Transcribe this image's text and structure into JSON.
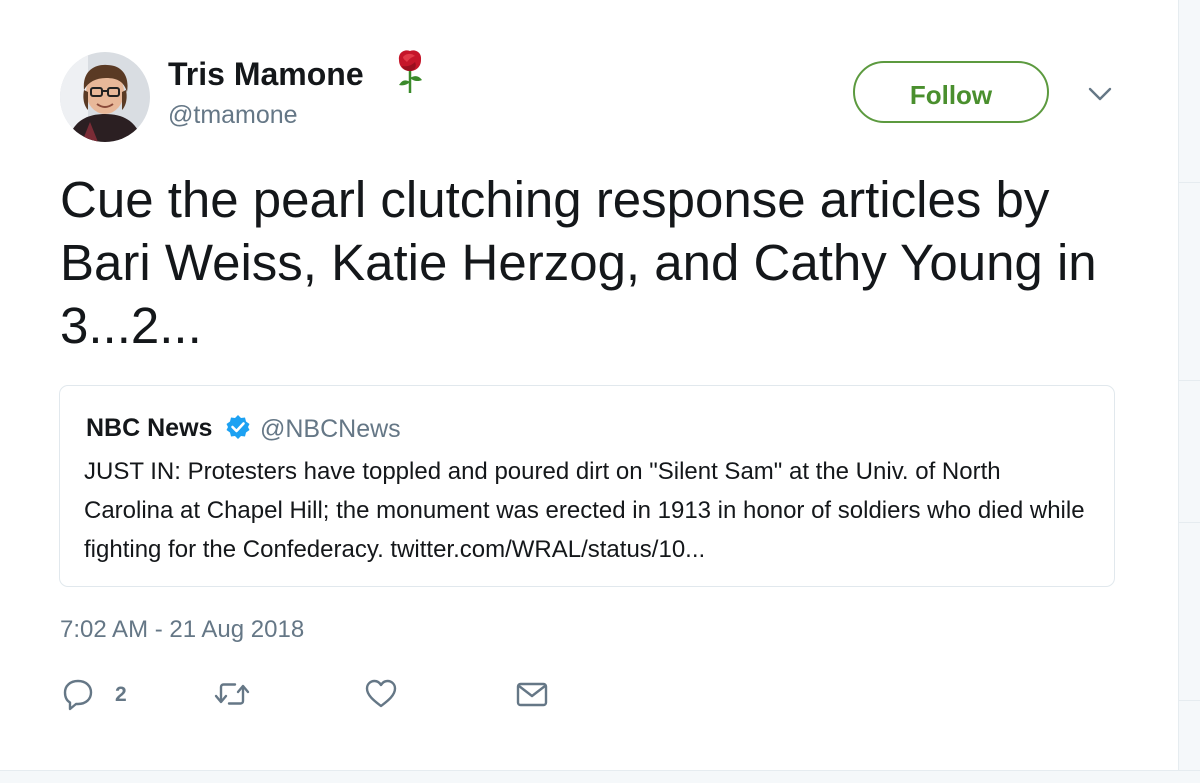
{
  "author": {
    "name": "Tris Mamone",
    "handle": "@tmamone",
    "name_emoji": "rose-icon"
  },
  "follow_button": {
    "label": "Follow",
    "color": "#4a8f2e"
  },
  "tweet": {
    "text": "Cue the pearl clutching response articles by Bari Weiss, Katie Herzog, and Cathy Young in 3...2...",
    "timestamp": "7:02 AM - 21 Aug 2018"
  },
  "quoted_tweet": {
    "name": "NBC News",
    "handle": "@NBCNews",
    "verified": true,
    "text": "JUST IN: Protesters have toppled and poured dirt on \"Silent Sam\" at the Univ. of North Carolina at Chapel Hill; the monument was erected in 1913 in honor of soldiers who died while fighting for the Confederacy. twitter.com/WRAL/status/10..."
  },
  "actions": {
    "reply_icon": "reply-icon",
    "reply_count": "2",
    "retweet_icon": "retweet-icon",
    "like_icon": "heart-icon",
    "dm_icon": "envelope-icon"
  },
  "colors": {
    "text": "#14171a",
    "secondary": "#657786",
    "verified_badge": "#1da1f2",
    "border": "#e1e8ed"
  }
}
